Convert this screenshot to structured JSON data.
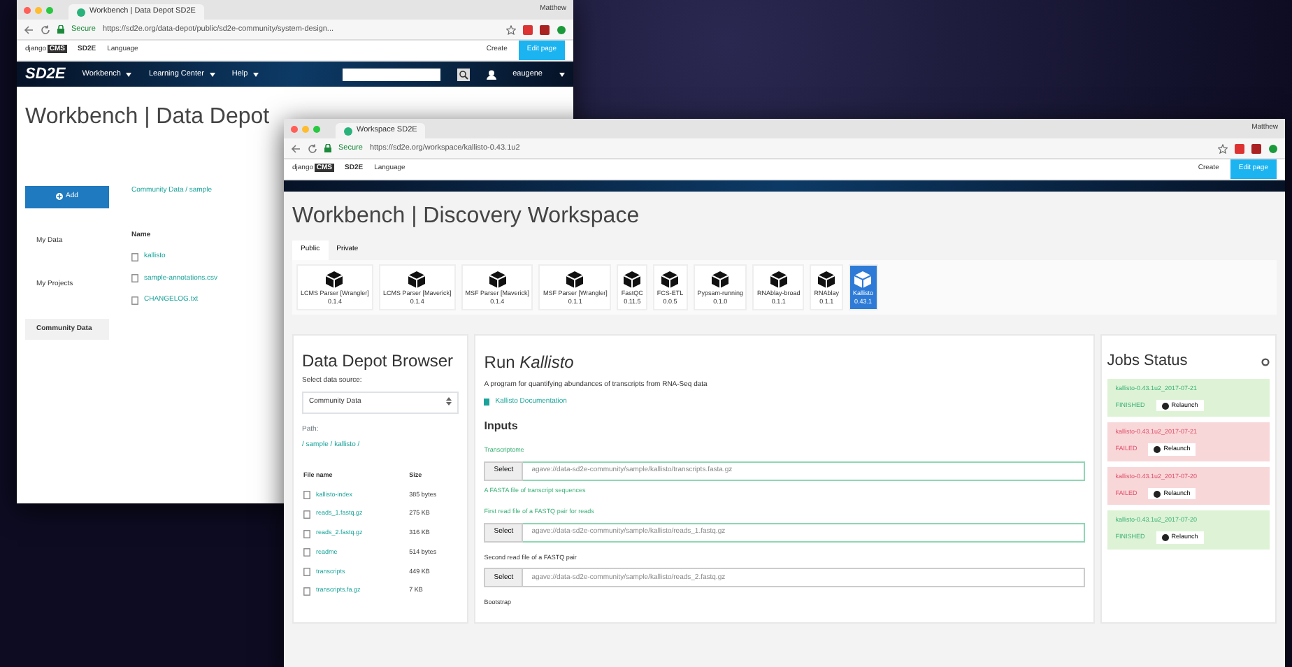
{
  "back_window": {
    "tab_title": "Workbench | Data Depot SD2E",
    "user": "Matthew",
    "secure_label": "Secure",
    "url": "https://sd2e.org/data-depot/public/sd2e-community/system-design...",
    "cms": {
      "logo": "django",
      "logo_badge": "CMS",
      "site": "SD2E",
      "language": "Language",
      "create": "Create",
      "edit_page": "Edit page"
    },
    "nav": {
      "logo": "SD2E",
      "items": [
        "Workbench",
        "Learning Center",
        "Help"
      ],
      "user": "eaugene"
    },
    "heading": "Workbench | Data Depot",
    "add_button": "Add",
    "sidebar": [
      {
        "label": "My Data",
        "selected": false
      },
      {
        "label": "My Projects",
        "selected": false
      },
      {
        "label": "Community Data",
        "selected": true
      }
    ],
    "breadcrumb": "Community Data / sample",
    "files": {
      "column": "Name",
      "rows": [
        "kallisto",
        "sample-annotations.csv",
        "CHANGELOG.txt"
      ]
    }
  },
  "front_window": {
    "tab_title": "Workspace SD2E",
    "user": "Matthew",
    "secure_label": "Secure",
    "url": "https://sd2e.org/workspace/kallisto-0.43.1u2",
    "cms": {
      "logo": "django",
      "logo_badge": "CMS",
      "site": "SD2E",
      "language": "Language",
      "create": "Create",
      "edit_page": "Edit page"
    },
    "heading": "Workbench | Discovery Workspace",
    "tabs": [
      {
        "label": "Public",
        "selected": true
      },
      {
        "label": "Private",
        "selected": false
      }
    ],
    "apps": [
      {
        "name": "LCMS Parser [Wrangler]",
        "version": "0.1.4",
        "selected": false
      },
      {
        "name": "LCMS Parser [Maverick]",
        "version": "0.1.4",
        "selected": false
      },
      {
        "name": "MSF Parser [Maverick]",
        "version": "0.1.4",
        "selected": false
      },
      {
        "name": "MSF Parser [Wrangler]",
        "version": "0.1.1",
        "selected": false
      },
      {
        "name": "FastQC",
        "version": "0.11.5",
        "selected": false
      },
      {
        "name": "FCS-ETL",
        "version": "0.0.5",
        "selected": false
      },
      {
        "name": "Pypsam-running",
        "version": "0.1.0",
        "selected": false
      },
      {
        "name": "RNAblay-broad",
        "version": "0.1.1",
        "selected": false
      },
      {
        "name": "RNAblay",
        "version": "0.1.1",
        "selected": false
      },
      {
        "name": "Kallisto",
        "version": "0.43.1",
        "selected": true
      }
    ],
    "browser": {
      "title": "Data Depot Browser",
      "source_label": "Select data source:",
      "source": "Community Data",
      "path_label": "Path:",
      "path": "/ sample / kallisto /",
      "columns": [
        "File name",
        "Size"
      ],
      "rows": [
        {
          "name": "kallisto-index",
          "size": "385 bytes"
        },
        {
          "name": "reads_1.fastq.gz",
          "size": "275 KB"
        },
        {
          "name": "reads_2.fastq.gz",
          "size": "316 KB"
        },
        {
          "name": "readme",
          "size": "514 bytes"
        },
        {
          "name": "transcripts",
          "size": "449 KB"
        },
        {
          "name": "transcripts.fa.gz",
          "size": "7 KB"
        }
      ]
    },
    "run": {
      "title": "Run *Kallisto*",
      "description": "A program for quantifying abundances of transcripts from RNA-Seq data",
      "doc_link": "Kallisto Documentation",
      "inputs_heading": "Inputs",
      "inputs": [
        {
          "label": "Transcriptome",
          "button": "Select",
          "value": "agave://data-sd2e-community/sample/kallisto/transcripts.fasta.gz",
          "help": "A FASTA file of transcript sequences",
          "focused": true
        },
        {
          "label": "First read file of a FASTQ pair for reads",
          "button": "Select",
          "value": "agave://data-sd2e-community/sample/kallisto/reads_1.fastq.gz",
          "focused": true
        },
        {
          "label": "Second read file of a FASTQ pair",
          "button": "Select",
          "value": "agave://data-sd2e-community/sample/kallisto/reads_2.fastq.gz",
          "focused": false
        }
      ],
      "next_label": "Bootstrap"
    },
    "jobs": {
      "title": "Jobs Status",
      "items": [
        {
          "kind": "finished",
          "name": "kallisto-0.43.1u2_2017-07-21",
          "status": "FINISHED",
          "action": "Relaunch"
        },
        {
          "kind": "failed",
          "name": "kallisto-0.43.1u2_2017-07-21",
          "status": "FAILED",
          "action": "Relaunch"
        },
        {
          "kind": "failed",
          "name": "kallisto-0.43.1u2_2017-07-20",
          "status": "FAILED",
          "action": "Relaunch"
        },
        {
          "kind": "finished",
          "name": "kallisto-0.43.1u2_2017-07-20",
          "status": "FINISHED",
          "action": "Relaunch"
        }
      ]
    }
  }
}
